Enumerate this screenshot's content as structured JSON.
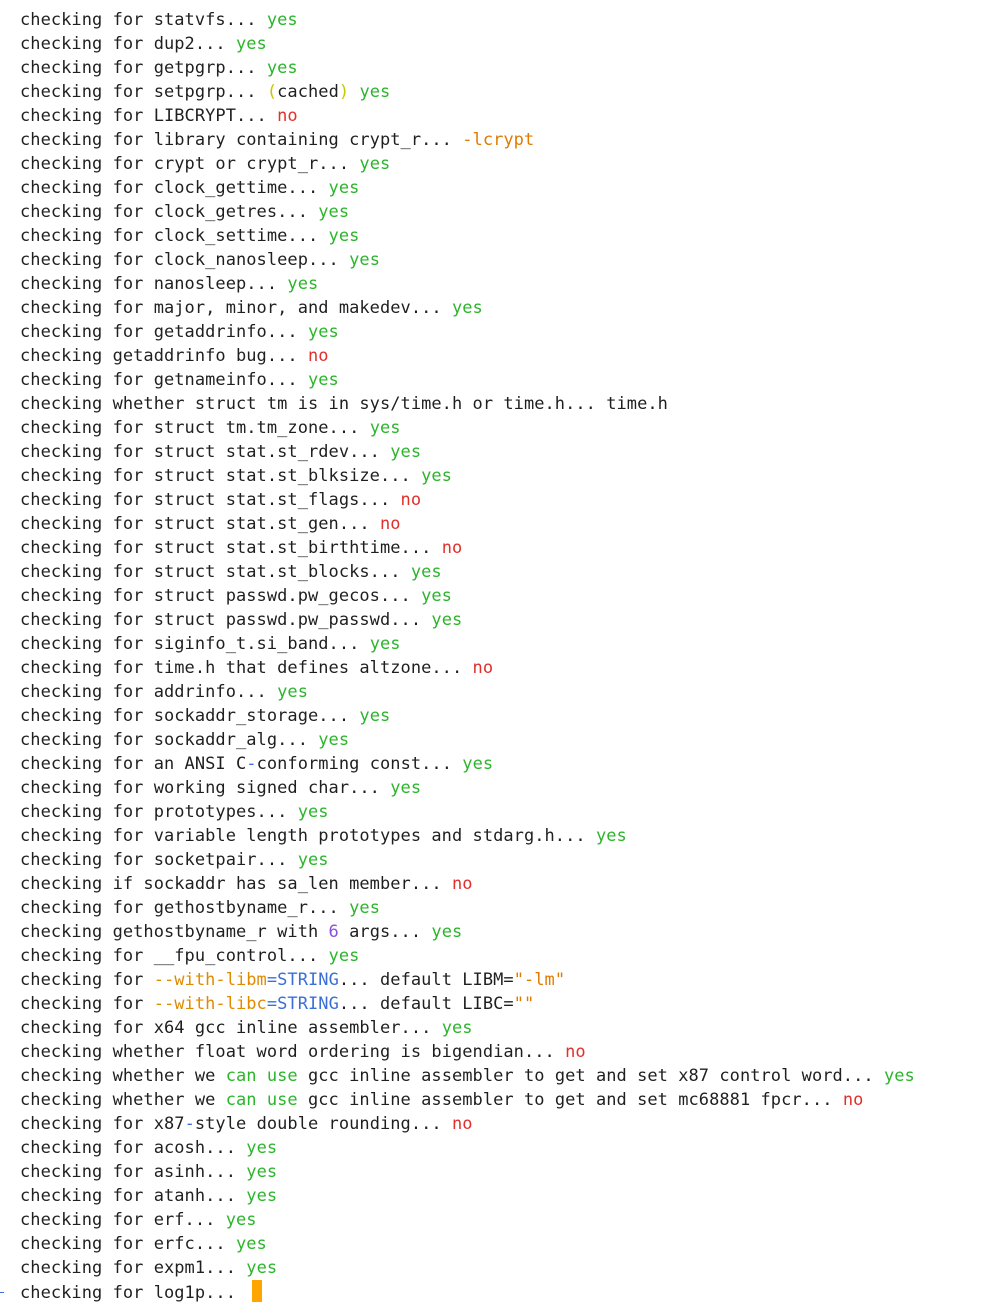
{
  "terminal": {
    "lines": [
      [
        {
          "t": "checking for statvfs... "
        },
        {
          "t": "yes",
          "c": "yes"
        }
      ],
      [
        {
          "t": "checking for dup2... "
        },
        {
          "t": "yes",
          "c": "yes"
        }
      ],
      [
        {
          "t": "checking for getpgrp... "
        },
        {
          "t": "yes",
          "c": "yes"
        }
      ],
      [
        {
          "t": "checking for setpgrp... "
        },
        {
          "t": "(",
          "c": "paren"
        },
        {
          "t": "cached"
        },
        {
          "t": ")",
          "c": "paren"
        },
        {
          "t": " "
        },
        {
          "t": "yes",
          "c": "yes"
        }
      ],
      [
        {
          "t": "checking for LIBCRYPT... "
        },
        {
          "t": "no",
          "c": "no"
        }
      ],
      [
        {
          "t": "checking for library containing crypt_r... "
        },
        {
          "t": "-lcrypt",
          "c": "orange"
        }
      ],
      [
        {
          "t": "checking for crypt or crypt_r... "
        },
        {
          "t": "yes",
          "c": "yes"
        }
      ],
      [
        {
          "t": "checking for clock_gettime... "
        },
        {
          "t": "yes",
          "c": "yes"
        }
      ],
      [
        {
          "t": "checking for clock_getres... "
        },
        {
          "t": "yes",
          "c": "yes"
        }
      ],
      [
        {
          "t": "checking for clock_settime... "
        },
        {
          "t": "yes",
          "c": "yes"
        }
      ],
      [
        {
          "t": "checking for clock_nanosleep... "
        },
        {
          "t": "yes",
          "c": "yes"
        }
      ],
      [
        {
          "t": "checking for nanosleep... "
        },
        {
          "t": "yes",
          "c": "yes"
        }
      ],
      [
        {
          "t": "checking for major, minor, and makedev... "
        },
        {
          "t": "yes",
          "c": "yes"
        }
      ],
      [
        {
          "t": "checking for getaddrinfo... "
        },
        {
          "t": "yes",
          "c": "yes"
        }
      ],
      [
        {
          "t": "checking getaddrinfo bug... "
        },
        {
          "t": "no",
          "c": "no"
        }
      ],
      [
        {
          "t": "checking for getnameinfo... "
        },
        {
          "t": "yes",
          "c": "yes"
        }
      ],
      [
        {
          "t": "checking whether struct tm is in sys/time.h or time.h... time.h"
        }
      ],
      [
        {
          "t": "checking for struct tm.tm_zone... "
        },
        {
          "t": "yes",
          "c": "yes"
        }
      ],
      [
        {
          "t": "checking for struct stat.st_rdev... "
        },
        {
          "t": "yes",
          "c": "yes"
        }
      ],
      [
        {
          "t": "checking for struct stat.st_blksize... "
        },
        {
          "t": "yes",
          "c": "yes"
        }
      ],
      [
        {
          "t": "checking for struct stat.st_flags... "
        },
        {
          "t": "no",
          "c": "no"
        }
      ],
      [
        {
          "t": "checking for struct stat.st_gen... "
        },
        {
          "t": "no",
          "c": "no"
        }
      ],
      [
        {
          "t": "checking for struct stat.st_birthtime... "
        },
        {
          "t": "no",
          "c": "no"
        }
      ],
      [
        {
          "t": "checking for struct stat.st_blocks... "
        },
        {
          "t": "yes",
          "c": "yes"
        }
      ],
      [
        {
          "t": "checking for struct passwd.pw_gecos... "
        },
        {
          "t": "yes",
          "c": "yes"
        }
      ],
      [
        {
          "t": "checking for struct passwd.pw_passwd... "
        },
        {
          "t": "yes",
          "c": "yes"
        }
      ],
      [
        {
          "t": "checking for siginfo_t.si_band... "
        },
        {
          "t": "yes",
          "c": "yes"
        }
      ],
      [
        {
          "t": "checking for time.h that defines altzone... "
        },
        {
          "t": "no",
          "c": "no"
        }
      ],
      [
        {
          "t": "checking for addrinfo... "
        },
        {
          "t": "yes",
          "c": "yes"
        }
      ],
      [
        {
          "t": "checking for sockaddr_storage... "
        },
        {
          "t": "yes",
          "c": "yes"
        }
      ],
      [
        {
          "t": "checking for sockaddr_alg... "
        },
        {
          "t": "yes",
          "c": "yes"
        }
      ],
      [
        {
          "t": "checking for an ANSI C"
        },
        {
          "t": "-",
          "c": "dash"
        },
        {
          "t": "conforming const... "
        },
        {
          "t": "yes",
          "c": "yes"
        }
      ],
      [
        {
          "t": "checking for working signed char... "
        },
        {
          "t": "yes",
          "c": "yes"
        }
      ],
      [
        {
          "t": "checking for prototypes... "
        },
        {
          "t": "yes",
          "c": "yes"
        }
      ],
      [
        {
          "t": "checking for variable length prototypes and stdarg.h... "
        },
        {
          "t": "yes",
          "c": "yes"
        }
      ],
      [
        {
          "t": "checking for socketpair... "
        },
        {
          "t": "yes",
          "c": "yes"
        }
      ],
      [
        {
          "t": "checking if sockaddr has sa_len member... "
        },
        {
          "t": "no",
          "c": "no"
        }
      ],
      [
        {
          "t": "checking for gethostbyname_r... "
        },
        {
          "t": "yes",
          "c": "yes"
        }
      ],
      [
        {
          "t": "checking gethostbyname_r with "
        },
        {
          "t": "6",
          "c": "num"
        },
        {
          "t": " args... "
        },
        {
          "t": "yes",
          "c": "yes"
        }
      ],
      [
        {
          "t": "checking for __fpu_control... "
        },
        {
          "t": "yes",
          "c": "yes"
        }
      ],
      [
        {
          "t": "checking for "
        },
        {
          "t": "--with-libm",
          "c": "opt"
        },
        {
          "t": "=",
          "c": "dash"
        },
        {
          "t": "STRING",
          "c": "blue"
        },
        {
          "t": "... default LIBM="
        },
        {
          "t": "\"-lm\"",
          "c": "orange"
        }
      ],
      [
        {
          "t": "checking for "
        },
        {
          "t": "--with-libc",
          "c": "opt"
        },
        {
          "t": "=",
          "c": "dash"
        },
        {
          "t": "STRING",
          "c": "blue"
        },
        {
          "t": "... default LIBC="
        },
        {
          "t": "\"\"",
          "c": "orange"
        }
      ],
      [
        {
          "t": "checking for x64 gcc inline assembler... "
        },
        {
          "t": "yes",
          "c": "yes"
        }
      ],
      [
        {
          "t": "checking whether float word ordering is bigendian... "
        },
        {
          "t": "no",
          "c": "no"
        }
      ],
      [
        {
          "t": "checking whether we "
        },
        {
          "t": "can use",
          "c": "yes"
        },
        {
          "t": " gcc inline assembler to get and set x87 control word... "
        },
        {
          "t": "yes",
          "c": "yes"
        }
      ],
      [
        {
          "t": "checking whether we "
        },
        {
          "t": "can use",
          "c": "yes"
        },
        {
          "t": " gcc inline assembler to get and set mc68881 fpcr... "
        },
        {
          "t": "no",
          "c": "no"
        }
      ],
      [
        {
          "t": "checking for x87"
        },
        {
          "t": "-",
          "c": "dash"
        },
        {
          "t": "style double rounding... "
        },
        {
          "t": "no",
          "c": "no"
        }
      ],
      [
        {
          "t": "checking for acosh... "
        },
        {
          "t": "yes",
          "c": "yes"
        }
      ],
      [
        {
          "t": "checking for asinh... "
        },
        {
          "t": "yes",
          "c": "yes"
        }
      ],
      [
        {
          "t": "checking for atanh... "
        },
        {
          "t": "yes",
          "c": "yes"
        }
      ],
      [
        {
          "t": "checking for erf... "
        },
        {
          "t": "yes",
          "c": "yes"
        }
      ],
      [
        {
          "t": "checking for erfc... "
        },
        {
          "t": "yes",
          "c": "yes"
        }
      ],
      [
        {
          "t": "checking for expm1... "
        },
        {
          "t": "yes",
          "c": "yes"
        }
      ],
      [
        {
          "t": "checking for log1p... "
        }
      ]
    ],
    "colors": {
      "yes": "#2bb52b",
      "no": "#e0302b",
      "paren": "#c8c800",
      "orange": "#e07b00",
      "opt": "#e08a00",
      "blue": "#3a6fd8",
      "num": "#8a4fe0",
      "dash": "#3a6fd8",
      "cursor": "#ffa500",
      "background": "#ffffff",
      "foreground": "#1f1f1f"
    },
    "cursor_icon": "block-cursor-icon"
  }
}
